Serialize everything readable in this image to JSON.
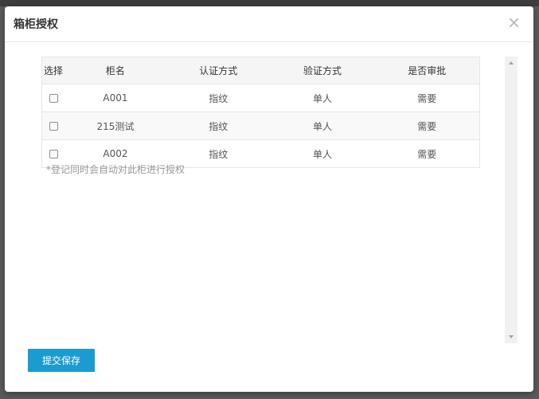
{
  "modal": {
    "title": "箱柜授权",
    "close_icon": "×"
  },
  "table": {
    "columns": [
      "选择",
      "柜名",
      "认证方式",
      "验证方式",
      "是否审批"
    ],
    "rows": [
      {
        "checked": false,
        "name": "A001",
        "auth": "指纹",
        "verify": "单人",
        "approval": "需要"
      },
      {
        "checked": false,
        "name": "215测试",
        "auth": "指纹",
        "verify": "单人",
        "approval": "需要"
      },
      {
        "checked": false,
        "name": "A002",
        "auth": "指纹",
        "verify": "单人",
        "approval": "需要"
      }
    ]
  },
  "note": "*登记同时会自动对此柜进行授权",
  "submit_label": "提交保存",
  "colors": {
    "primary_button": "#1c9bd1",
    "header_row": "#f5f5f5",
    "note_text": "#999999"
  }
}
